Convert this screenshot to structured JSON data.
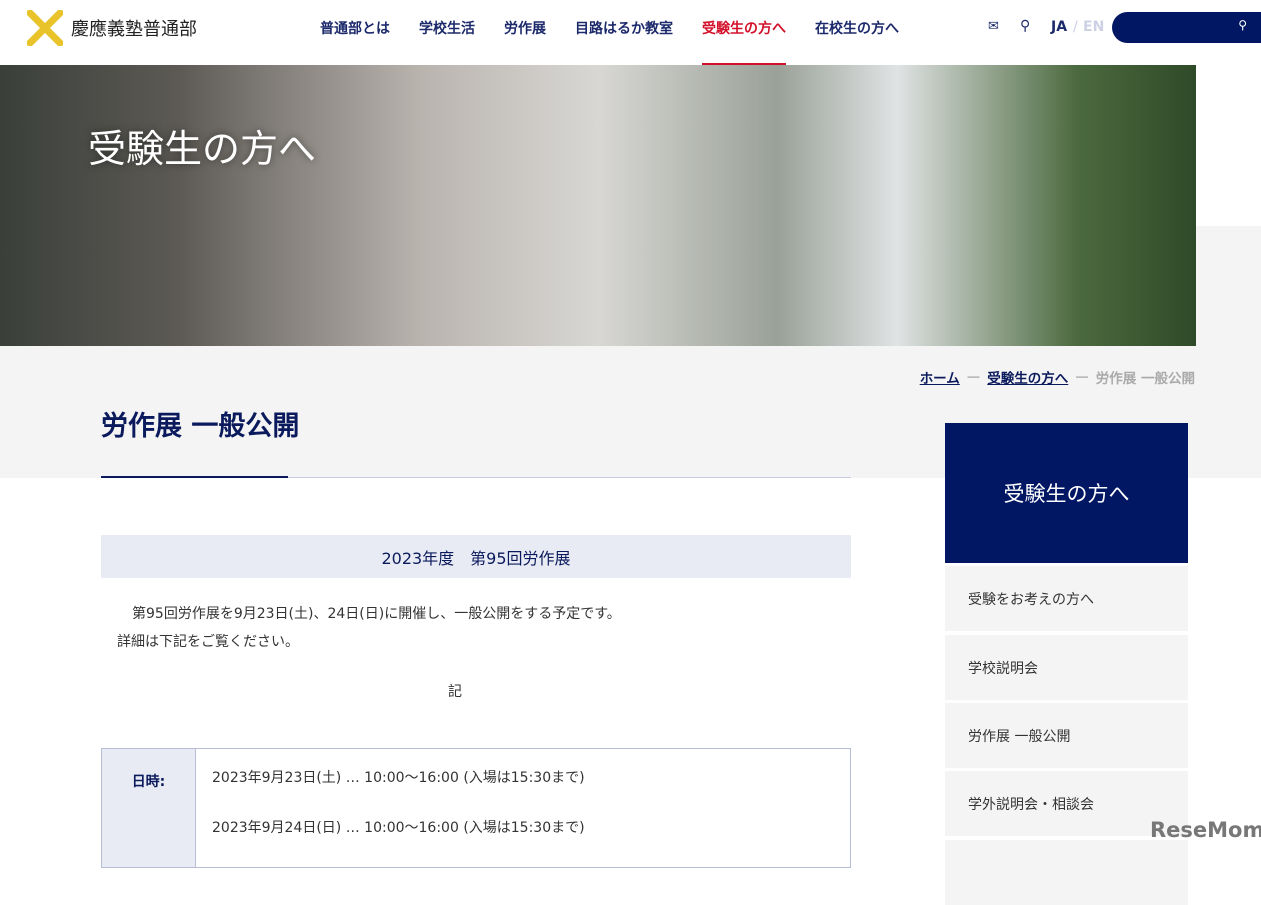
{
  "header": {
    "logo_text": "慶應義塾普通部",
    "nav": [
      "普通部とは",
      "学校生活",
      "労作展",
      "目路はるか教室",
      "受験生の方へ",
      "在校生の方へ"
    ],
    "active_nav": "受験生の方へ",
    "lang_ja": "JA",
    "lang_sep": "/",
    "lang_en": "EN"
  },
  "hero": {
    "title": "受験生の方へ"
  },
  "breadcrumb": {
    "home": "ホーム",
    "parent": "受験生の方へ",
    "current": "労作展 一般公開",
    "sep": "—"
  },
  "page": {
    "title": "労作展 一般公開",
    "section_heading": "2023年度　第95回労作展",
    "para1": "第95回労作展を9月23日(土)、24日(日)に開催し、一般公開をする予定です。",
    "para2": "詳細は下記をご覧ください。",
    "ki": "記",
    "table": {
      "label": "日時:",
      "rows": [
        "2023年9月23日(土) … 10:00〜16:00 (入場は15:30まで)",
        "2023年9月24日(日) … 10:00〜16:00 (入場は15:30まで)"
      ]
    }
  },
  "sidebar": {
    "heading": "受験生の方へ",
    "items": [
      "受験をお考えの方へ",
      "学校説明会",
      "労作展 一般公開",
      "学外説明会・相談会"
    ]
  },
  "watermark": "ReseMom"
}
